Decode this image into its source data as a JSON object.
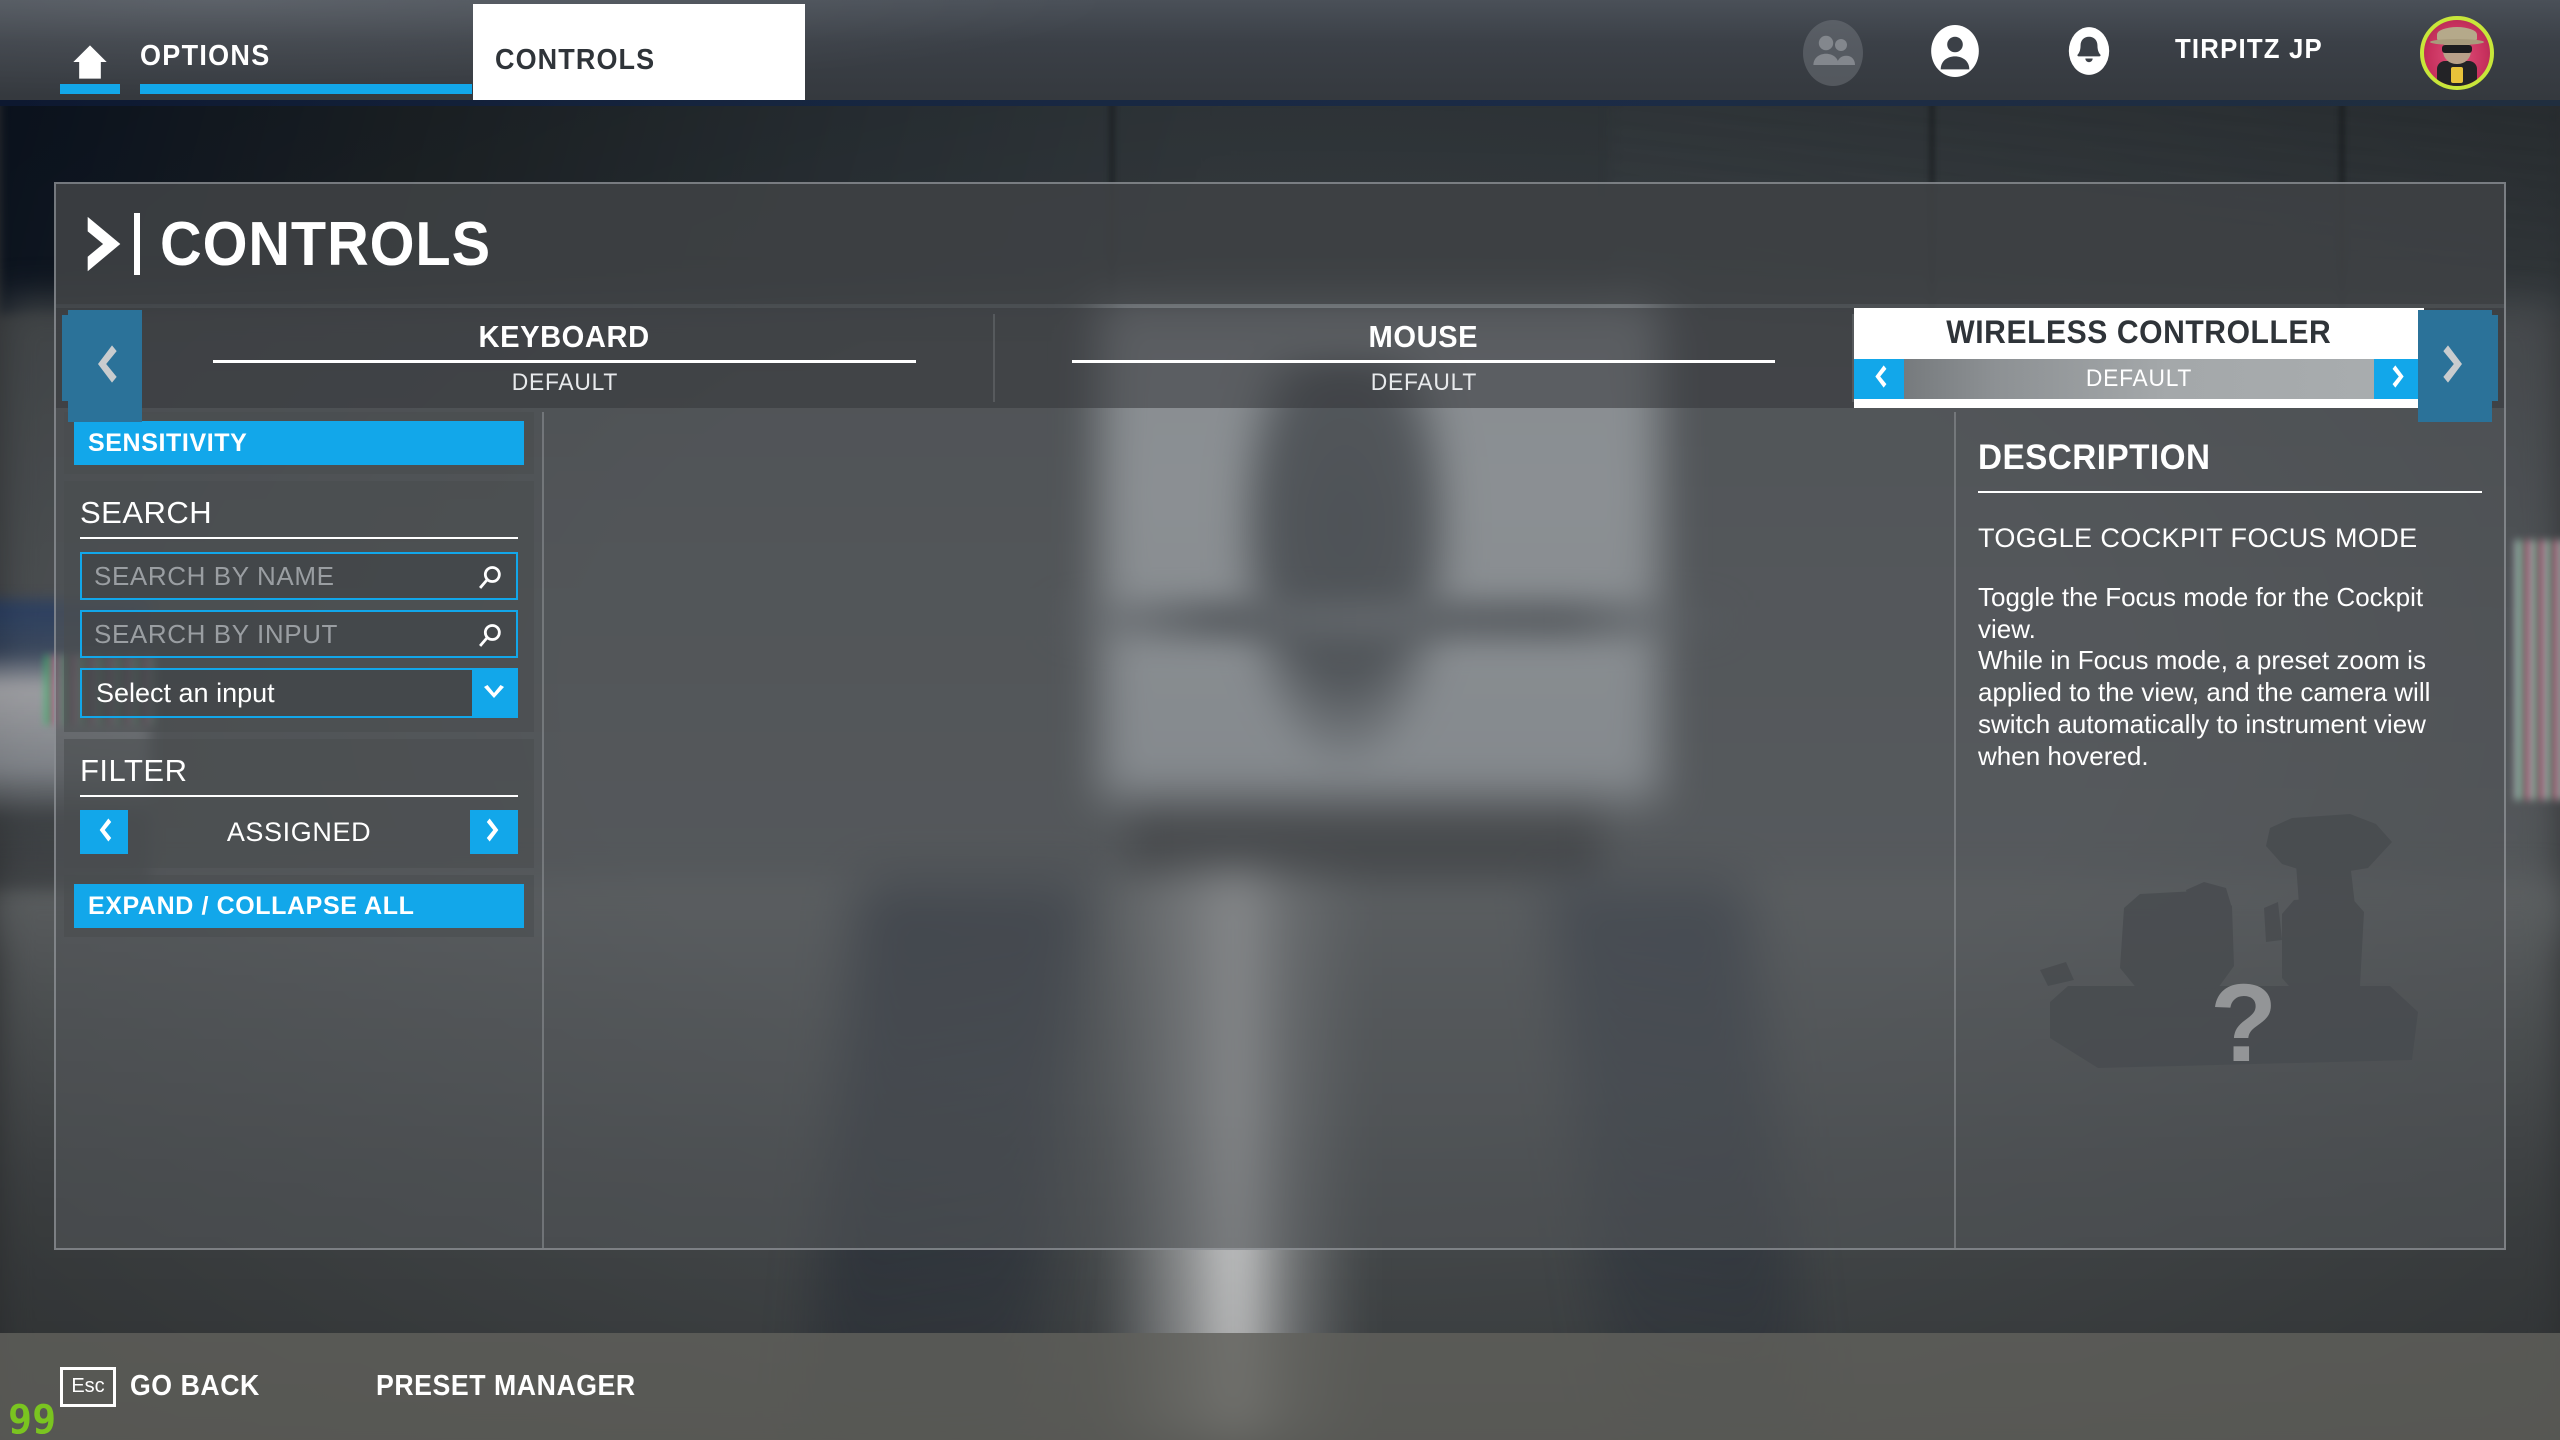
{
  "topnav": {
    "home_icon": "home-icon",
    "tabs": [
      {
        "label": "OPTIONS",
        "active": true
      },
      {
        "label": "CONTROLS",
        "active": true
      }
    ],
    "icons": [
      {
        "name": "friends-icon"
      },
      {
        "name": "profile-icon"
      },
      {
        "name": "bell-icon"
      }
    ],
    "username": "TIRPITZ JP",
    "avatar_name": "user-avatar"
  },
  "page": {
    "title": "CONTROLS",
    "chevron_icon": "chevron-right-icon"
  },
  "devices": {
    "prev_icon": "chevron-left-icon",
    "next_icon": "chevron-right-icon",
    "tabs": [
      {
        "name": "KEYBOARD",
        "preset": "DEFAULT",
        "active": false
      },
      {
        "name": "MOUSE",
        "preset": "DEFAULT",
        "active": false
      },
      {
        "name": "WIRELESS CONTROLLER",
        "preset": "DEFAULT",
        "active": true
      }
    ]
  },
  "sidebar": {
    "sensitivity_label": "SENSITIVITY",
    "search_header": "SEARCH",
    "search_by_name_placeholder": "SEARCH BY NAME",
    "search_by_name_value": "",
    "search_by_input_placeholder": "SEARCH BY INPUT",
    "search_by_input_value": "",
    "input_select_value": "Select an input",
    "filter_header": "FILTER",
    "filter_value": "ASSIGNED",
    "expand_collapse_label": "EXPAND / COLLAPSE ALL",
    "search_icon": "magnifier-icon",
    "dropdown_icon": "chevron-down-icon",
    "filter_prev_icon": "chevron-left-icon",
    "filter_next_icon": "chevron-right-icon"
  },
  "description": {
    "header": "DESCRIPTION",
    "binding_name": "TOGGLE COCKPIT FOCUS MODE",
    "body": "Toggle the Focus mode for the Cockpit view.\nWhile in Focus mode, a preset zoom is applied to the view, and the camera will switch automatically to instrument view when hovered.",
    "placeholder_icon": "joystick-silhouette-icon",
    "question_mark": "?"
  },
  "bottombar": {
    "esc_key": "Esc",
    "go_back_label": "GO BACK",
    "preset_manager_label": "PRESET MANAGER"
  },
  "overlay": {
    "fps_counter": "99",
    "fps_color": "#7ac420"
  },
  "colors": {
    "accent_blue": "#12a7ea",
    "arrow_panel_blue": "#2b7299",
    "panel_bg": "rgba(72,76,79,0.55)",
    "white": "#ffffff"
  }
}
